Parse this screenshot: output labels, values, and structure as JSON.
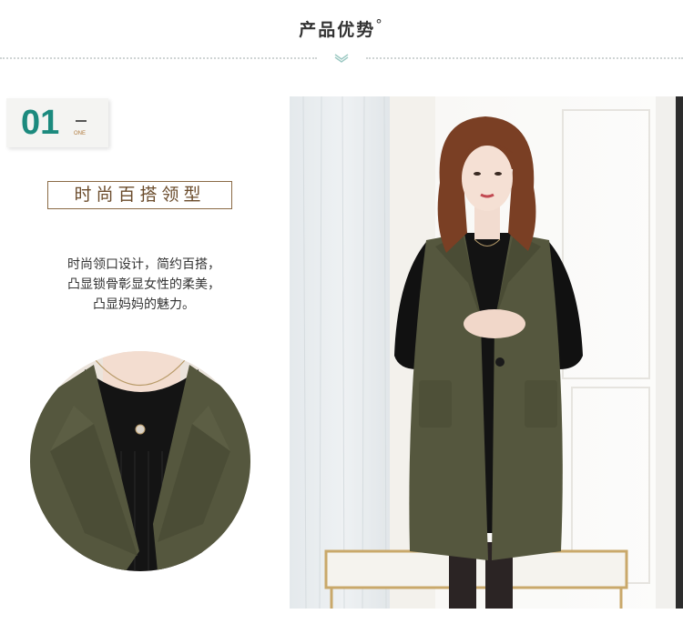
{
  "header": {
    "title": "产品优势",
    "title_mark": "°"
  },
  "feature": {
    "number": "01",
    "number_sub": "ONE",
    "heading": "时尚百搭领型",
    "description": [
      "时尚领口设计，简约百搭，",
      "凸显锁骨彰显女性的柔美，",
      "凸显妈妈的魅力。"
    ]
  },
  "colors": {
    "accent_teal": "#1c8a7e",
    "heading_brown": "#6b4c2c",
    "coat_green": "#55573e"
  }
}
